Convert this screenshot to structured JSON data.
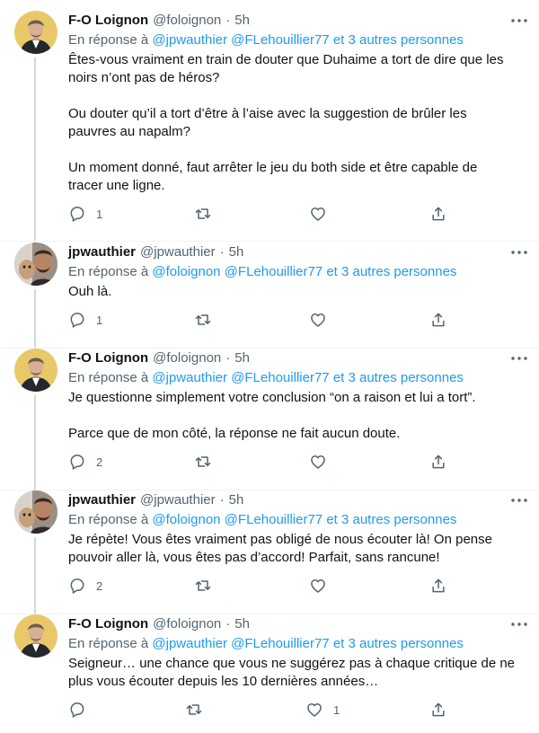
{
  "tweets": [
    {
      "name": "F-O Loignon",
      "handle": "@foloignon",
      "time": "5h",
      "reply_prefix": "En réponse à",
      "reply_mentions": "@jpwauthier @FLehouillier77",
      "reply_others": "et 3 autres personnes",
      "lines": [
        "Êtes-vous vraiment en train de douter que Duhaime a tort de dire que les",
        "noirs n’ont pas de héros?",
        "",
        "Ou douter qu’il a tort d’être à l’aise avec la suggestion de brûler les",
        "pauvres au napalm?",
        "",
        "Un moment donné, faut arrêter le jeu du both side et être capable de",
        "tracer une ligne."
      ],
      "reply_count": "1",
      "retweet_count": "",
      "like_count": ""
    },
    {
      "name": "jpwauthier",
      "handle": "@jpwauthier",
      "time": "5h",
      "reply_prefix": "En réponse à",
      "reply_mentions": "@foloignon @FLehouillier77",
      "reply_others": "et 3 autres personnes",
      "lines": [
        "Ouh là."
      ],
      "reply_count": "1",
      "retweet_count": "",
      "like_count": ""
    },
    {
      "name": "F-O Loignon",
      "handle": "@foloignon",
      "time": "5h",
      "reply_prefix": "En réponse à",
      "reply_mentions": "@jpwauthier @FLehouillier77",
      "reply_others": "et 3 autres personnes",
      "lines": [
        "Je questionne simplement votre conclusion “on a raison et lui a tort”.",
        "",
        "Parce que de mon côté, la réponse ne fait aucun doute."
      ],
      "reply_count": "2",
      "retweet_count": "",
      "like_count": ""
    },
    {
      "name": "jpwauthier",
      "handle": "@jpwauthier",
      "time": "5h",
      "reply_prefix": "En réponse à",
      "reply_mentions": "@foloignon @FLehouillier77",
      "reply_others": "et 3 autres personnes",
      "lines": [
        "Je répète! Vous êtes vraiment pas obligé de nous écouter là! On pense",
        "pouvoir aller là, vous êtes pas d’accord! Parfait, sans rancune!"
      ],
      "reply_count": "2",
      "retweet_count": "",
      "like_count": ""
    },
    {
      "name": "F-O Loignon",
      "handle": "@foloignon",
      "time": "5h",
      "reply_prefix": "En réponse à",
      "reply_mentions": "@jpwauthier @FLehouillier77",
      "reply_others": "et 3 autres personnes",
      "lines": [
        "Seigneur… une chance que vous ne suggérez pas à chaque critique de ne",
        "plus vous écouter depuis les 10 dernières années…"
      ],
      "reply_count": "",
      "retweet_count": "",
      "like_count": "1"
    }
  ],
  "dot": "·",
  "colors": {
    "text": "#0f1419",
    "secondary": "#536471",
    "link": "#1d9bf0",
    "thread_line": "#cfd9de"
  },
  "icons": {
    "reply": "reply-icon",
    "retweet": "retweet-icon",
    "like": "heart-icon",
    "share": "share-icon",
    "more": "more-icon"
  }
}
